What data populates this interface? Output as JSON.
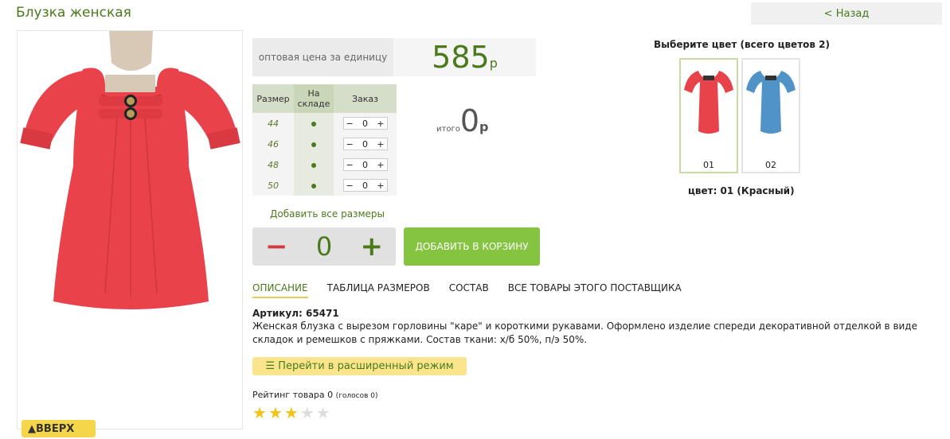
{
  "page_title": "Блузка женская",
  "back_label": "< Назад",
  "up_button": "▲ВВЕРХ",
  "price": {
    "label": "оптовая цена за единицу",
    "value": "585",
    "currency": "р"
  },
  "size_table": {
    "headers": [
      "Размер",
      "На складе",
      "Заказ"
    ],
    "rows": [
      {
        "size": "44",
        "qty": "0"
      },
      {
        "size": "46",
        "qty": "0"
      },
      {
        "size": "48",
        "qty": "0"
      },
      {
        "size": "50",
        "qty": "0"
      }
    ],
    "minus": "−",
    "plus": "+"
  },
  "total": {
    "label": "итого",
    "value": "0",
    "currency": "р"
  },
  "add_all_sizes": "Добавить все размеры",
  "quantity": {
    "minus": "−",
    "value": "0",
    "plus": "+"
  },
  "add_to_cart": "ДОБАВИТЬ В КОРЗИНУ",
  "tabs": [
    "ОПИСАНИЕ",
    "ТАБЛИЦА РАЗМЕРОВ",
    "СОСТАВ",
    "ВСЕ ТОВАРЫ ЭТОГО ПОСТАВЩИКА"
  ],
  "article": "Артикул: 65471",
  "description": "Женская блузка с вырезом горловины \"каре\" и короткими рукавами. Оформлено изделие спереди декоративной отделкой в виде складок и ремешков с пряжками. Состав ткани: х/б 50%, п/э 50%.",
  "advanced_mode": "Перейти в расширенный режим",
  "rating": {
    "label": "Рейтинг товара 0",
    "votes": "(голосов 0)",
    "stars": 2.5,
    "max": 5
  },
  "colors": {
    "title": "Выберите цвет (всего цветов 2)",
    "items": [
      {
        "label": "01",
        "color": "#e8434a"
      },
      {
        "label": "02",
        "color": "#4f93c8"
      }
    ],
    "selected_text": "цвет: 01 (Красный)"
  },
  "accent": "#4a7a1c"
}
